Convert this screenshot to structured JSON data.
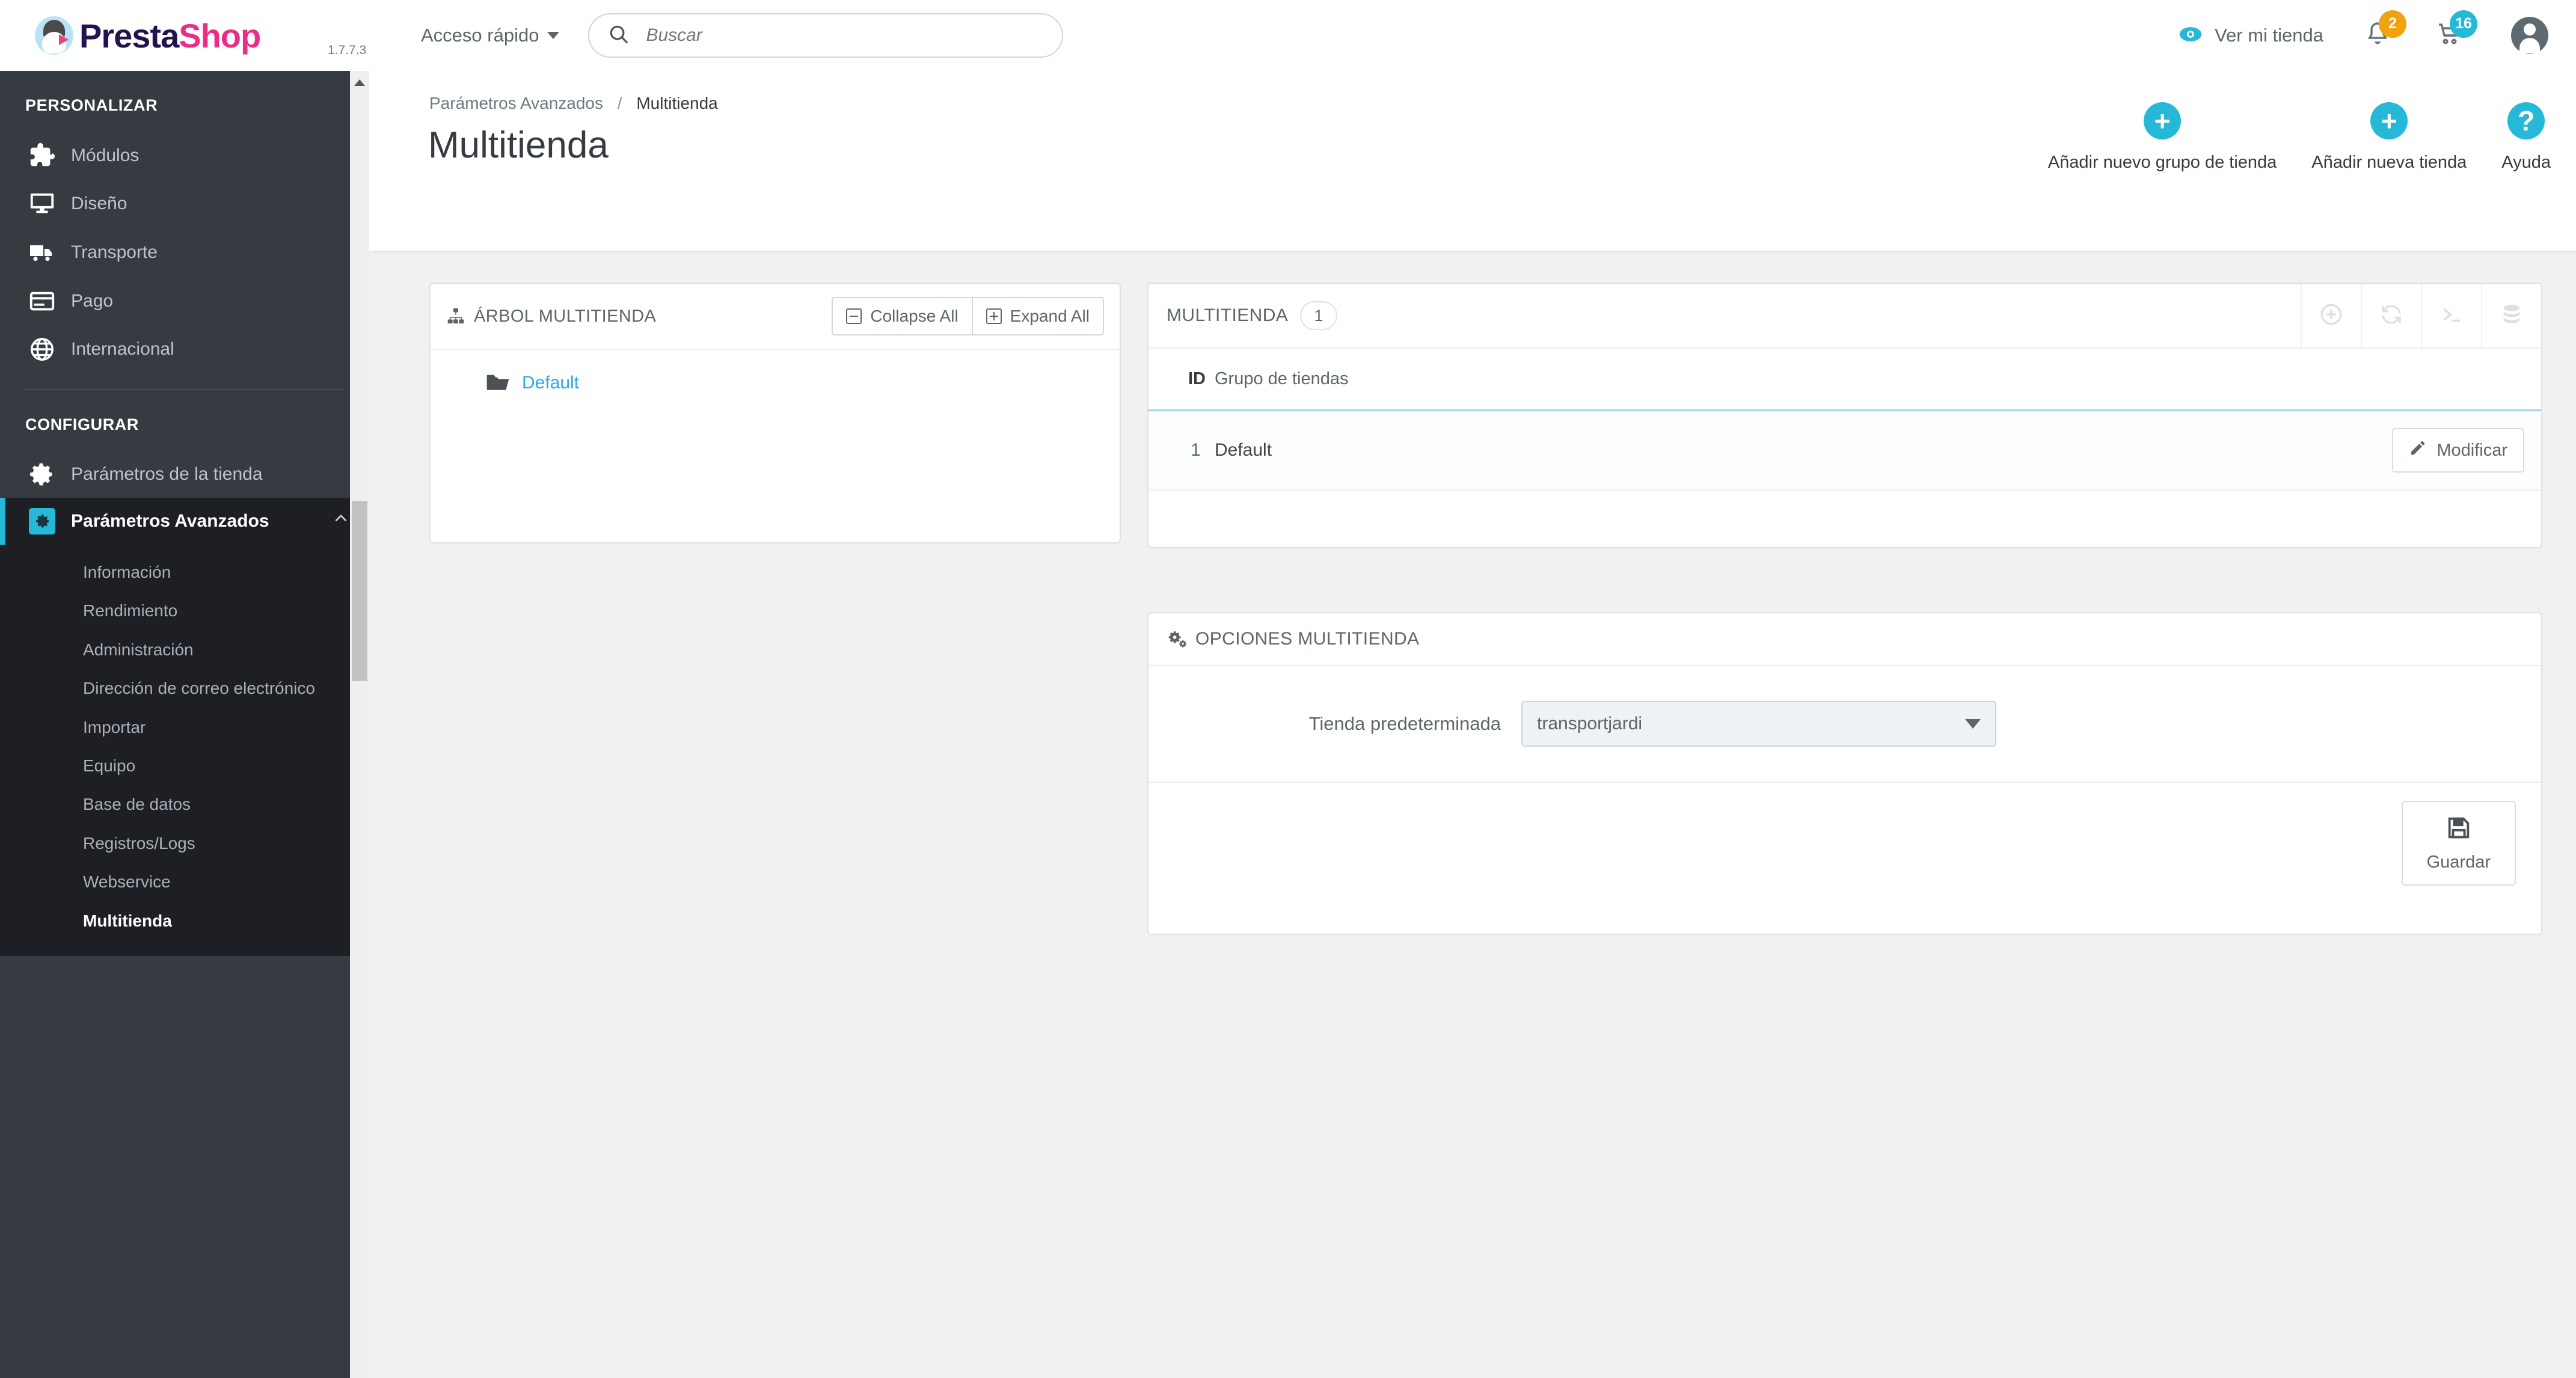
{
  "brand": {
    "name_part1": "Presta",
    "name_part2": "Shop",
    "version": "1.7.7.3",
    "logo_icon": "prestashop-bird-logo"
  },
  "topbar": {
    "quick_access_label": "Acceso rápido",
    "quick_access_icon": "chevron-down-icon",
    "search": {
      "placeholder": "Buscar",
      "value": "",
      "icon": "search-icon"
    },
    "view_shop_label": "Ver mi tienda",
    "view_shop_icon": "eye-icon",
    "notifications": {
      "icon": "bell-icon",
      "badge": "2",
      "badge_color": "#f0a30d"
    },
    "orders": {
      "icon": "cart-icon",
      "badge": "16",
      "badge_color": "#25b9d7"
    },
    "account_icon": "user-avatar-icon"
  },
  "sidebar": {
    "section_personalizar": "PERSONALIZAR",
    "section_configurar": "CONFIGURAR",
    "personalizar_items": [
      {
        "label": "Módulos",
        "icon": "puzzle-icon"
      },
      {
        "label": "Diseño",
        "icon": "monitor-icon"
      },
      {
        "label": "Transporte",
        "icon": "truck-icon"
      },
      {
        "label": "Pago",
        "icon": "credit-card-icon"
      },
      {
        "label": "Internacional",
        "icon": "globe-icon"
      }
    ],
    "configurar_items": [
      {
        "label": "Parámetros de la tienda",
        "icon": "gear-icon",
        "active": false
      },
      {
        "label": "Parámetros Avanzados",
        "icon": "gear-box-icon",
        "active": true,
        "caret": "chevron-up-icon"
      }
    ],
    "submenu_items": [
      {
        "label": "Información",
        "active": false
      },
      {
        "label": "Rendimiento",
        "active": false
      },
      {
        "label": "Administración",
        "active": false
      },
      {
        "label": "Dirección de correo electrónico",
        "active": false
      },
      {
        "label": "Importar",
        "active": false
      },
      {
        "label": "Equipo",
        "active": false
      },
      {
        "label": "Base de datos",
        "active": false
      },
      {
        "label": "Registros/Logs",
        "active": false
      },
      {
        "label": "Webservice",
        "active": false
      },
      {
        "label": "Multitienda",
        "active": true
      }
    ]
  },
  "page": {
    "breadcrumb_parent": "Parámetros Avanzados",
    "breadcrumb_sep": "/",
    "breadcrumb_current": "Multitienda",
    "title": "Multitienda",
    "actions": [
      {
        "label": "Añadir nuevo grupo de tienda",
        "icon": "plus-circle-icon",
        "glyph": "+"
      },
      {
        "label": "Añadir nueva tienda",
        "icon": "plus-circle-icon",
        "glyph": "+"
      },
      {
        "label": "Ayuda",
        "icon": "help-circle-icon",
        "glyph": "?"
      }
    ]
  },
  "tree_panel": {
    "title": "ÁRBOL MULTITIENDA",
    "title_icon": "sitemap-icon",
    "collapse_label": "Collapse All",
    "expand_label": "Expand All",
    "nodes": [
      {
        "label": "Default",
        "icon": "folder-open-icon"
      }
    ]
  },
  "store_panel": {
    "title": "MULTITIENDA",
    "count": "1",
    "tools": [
      {
        "icon": "plus-circle-icon"
      },
      {
        "icon": "refresh-icon"
      },
      {
        "icon": "terminal-icon"
      },
      {
        "icon": "database-icon"
      }
    ],
    "columns": [
      "ID",
      "Grupo de tiendas"
    ],
    "rows": [
      {
        "id": "1",
        "name": "Default",
        "action_label": "Modificar",
        "action_icon": "pencil-icon"
      }
    ]
  },
  "options_panel": {
    "title": "OPCIONES MULTITIENDA",
    "title_icon": "gears-icon",
    "field_label": "Tienda predeterminada",
    "field_value": "transportjardi",
    "field_icon": "chevron-down-icon",
    "save_label": "Guardar",
    "save_icon": "floppy-disk-icon"
  },
  "colors": {
    "accent": "#25b9d7",
    "sidebar_bg": "#363a41",
    "sidebar_active_bg": "#1d1f24",
    "brand_pink": "#ea2e87",
    "brand_purple": "#25124c",
    "content_bg": "#f1f1f1"
  }
}
